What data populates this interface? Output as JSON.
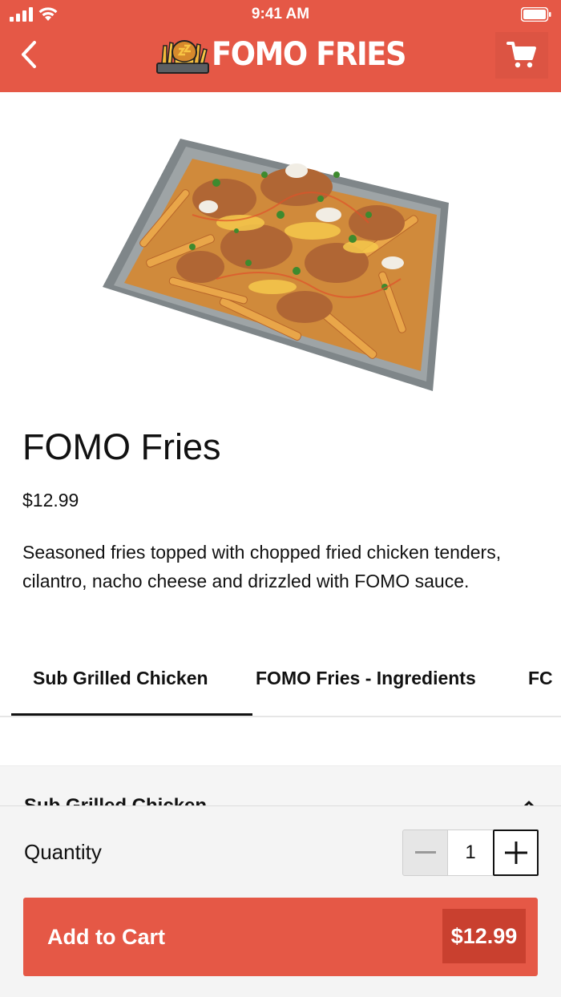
{
  "status_bar": {
    "time": "9:41 AM"
  },
  "header": {
    "brand": "FOMO FRIES"
  },
  "product": {
    "title": "FOMO Fries",
    "price": "$12.99",
    "description": "Seasoned fries topped with chopped fried chicken tenders, cilantro, nacho cheese and drizzled with FOMO sauce."
  },
  "tabs": [
    {
      "label": "Sub Grilled Chicken",
      "active": true
    },
    {
      "label": "FOMO Fries - Ingredients",
      "active": false
    },
    {
      "label": "FC",
      "active": false
    }
  ],
  "section": {
    "title": "Sub Grilled Chicken"
  },
  "bottom_bar": {
    "quantity_label": "Quantity",
    "quantity_value": "1",
    "add_to_cart_label": "Add to Cart",
    "add_to_cart_price": "$12.99"
  },
  "colors": {
    "brand": "#e55846",
    "brand_dark": "#c9402f"
  },
  "icons": [
    "signal-icon",
    "wifi-icon",
    "battery-icon",
    "back-chevron-icon",
    "fomo-logo-icon",
    "cart-icon",
    "chevron-up-icon",
    "minus-icon",
    "plus-icon"
  ]
}
